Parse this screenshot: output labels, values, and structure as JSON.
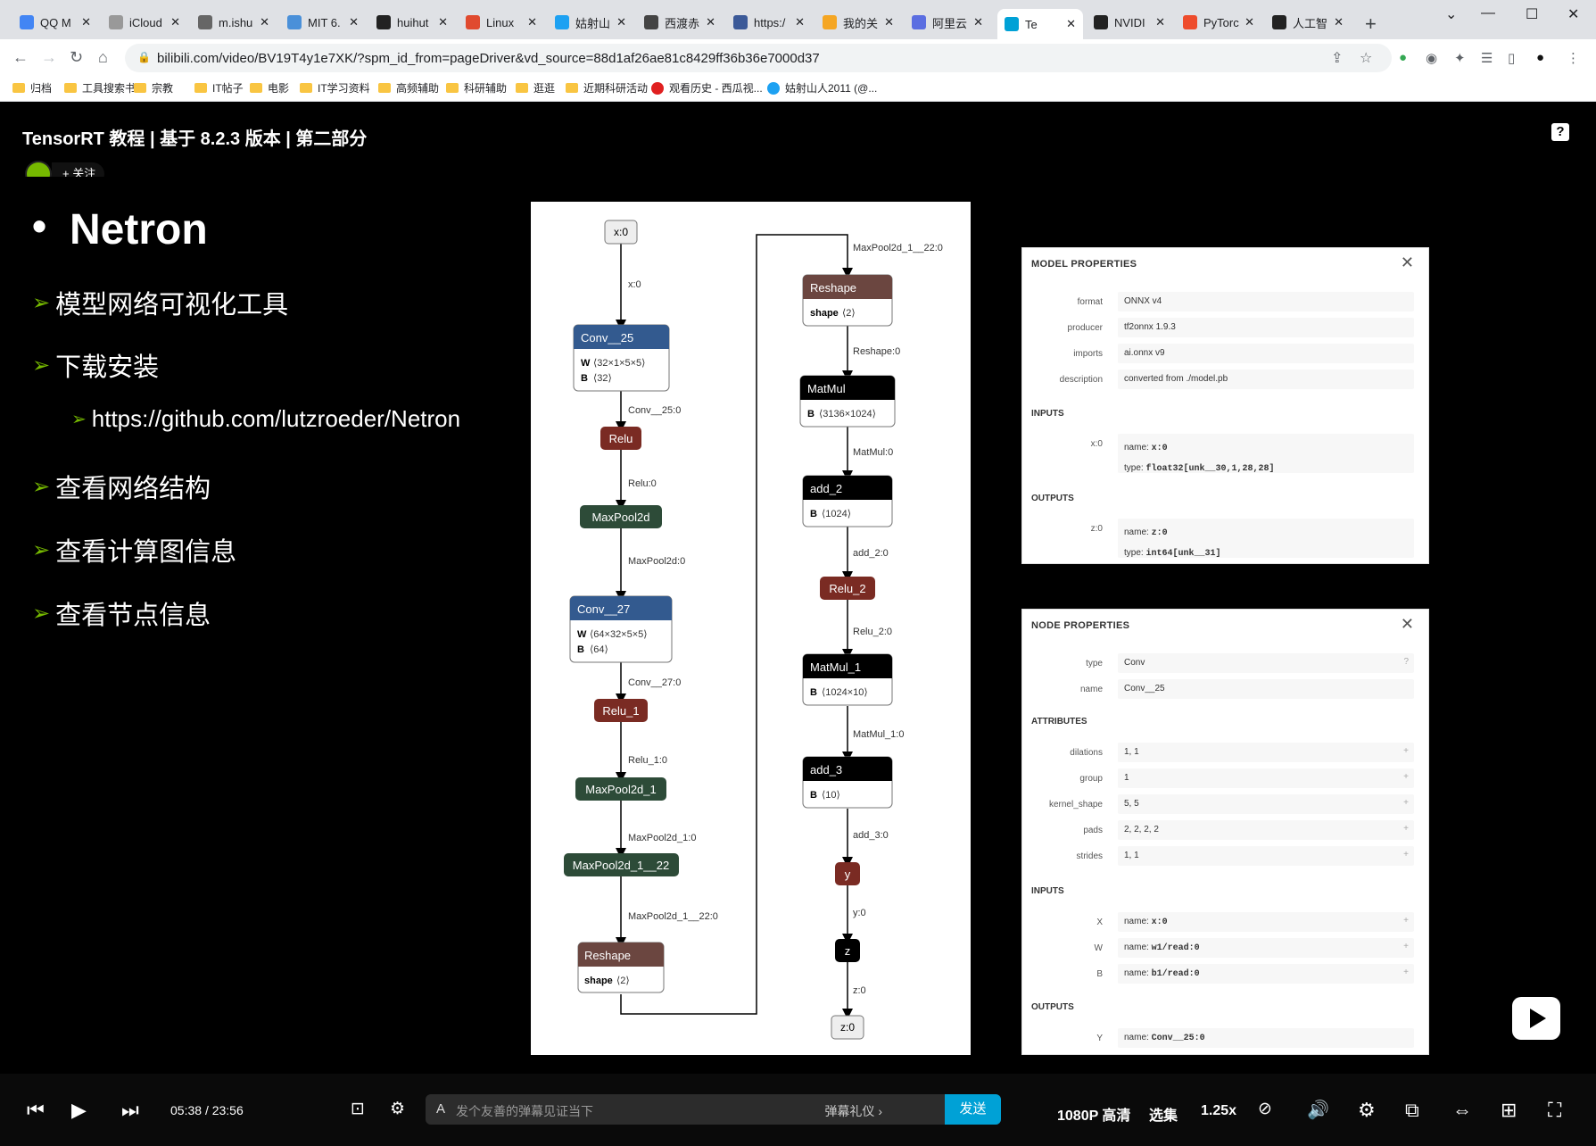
{
  "browser": {
    "tabs": [
      {
        "label": "QQ M",
        "color": "#4285f4"
      },
      {
        "label": "iCloud",
        "color": "#999999"
      },
      {
        "label": "m.ishu",
        "color": "#666666"
      },
      {
        "label": "MIT 6.",
        "color": "#4a90d9"
      },
      {
        "label": "huihut",
        "color": "#222222"
      },
      {
        "label": "Linux",
        "color": "#e04a2f"
      },
      {
        "label": "姑射山",
        "color": "#1da1f2"
      },
      {
        "label": "西渡赤",
        "color": "#444444"
      },
      {
        "label": "https:/",
        "color": "#3b5998"
      },
      {
        "label": "我的关",
        "color": "#f5a623"
      },
      {
        "label": "阿里云",
        "color": "#5b6ee1"
      },
      {
        "label": "Te",
        "color": "#00a1d6",
        "active": true
      },
      {
        "label": "NVIDI",
        "color": "#222222"
      },
      {
        "label": "PyTorc",
        "color": "#ee4c2c"
      },
      {
        "label": "人工智",
        "color": "#222222"
      }
    ],
    "url": "bilibili.com/video/BV19T4y1e7XK/?spm_id_from=pageDriver&vd_source=88d1af26ae81c8429ff36b36e7000d37",
    "bookmarks": [
      {
        "label": "归档",
        "type": "folder"
      },
      {
        "label": "工具搜索书",
        "type": "folder"
      },
      {
        "label": "宗教",
        "type": "folder"
      },
      {
        "label": "IT帖子",
        "type": "folder"
      },
      {
        "label": "电影",
        "type": "folder"
      },
      {
        "label": "IT学习资料",
        "type": "folder"
      },
      {
        "label": "高频辅助",
        "type": "folder"
      },
      {
        "label": "科研辅助",
        "type": "folder"
      },
      {
        "label": "逛逛",
        "type": "folder"
      },
      {
        "label": "近期科研活动",
        "type": "folder"
      },
      {
        "label": "观看历史 - 西瓜视...",
        "type": "site",
        "color": "#e02020"
      },
      {
        "label": "姑射山人2011 (@...",
        "type": "site",
        "color": "#1da1f2"
      }
    ]
  },
  "video": {
    "title": "TensorRT 教程 | 基于 8.2.3 版本 | 第二部分",
    "follow_label": "+ 关注",
    "current_time": "05:38",
    "separator": "/",
    "duration": "23:56",
    "danmaku_placeholder": "发个友善的弹幕见证当下",
    "danmaku_etiquette": "弹幕礼仪 ›",
    "send_label": "发送",
    "quality": "1080P 高清",
    "episodes": "选集",
    "speed": "1.25x"
  },
  "slide": {
    "title": "Netron",
    "items": [
      {
        "text": "模型网络可视化工具",
        "level": 1
      },
      {
        "text": "下载安装",
        "level": 1
      },
      {
        "text": "https://github.com/lutzroeder/Netron",
        "level": 2
      },
      {
        "text": "查看网络结构",
        "level": 1
      },
      {
        "text": "查看计算图信息",
        "level": 1
      },
      {
        "text": "查看节点信息",
        "level": 1
      }
    ]
  },
  "graph": {
    "input_node": "x:0",
    "output_node": "z:0",
    "edges_left": [
      "x:0",
      "Conv__25:0",
      "Relu:0",
      "MaxPool2d:0",
      "Conv__27:0",
      "Relu_1:0",
      "MaxPool2d_1:0",
      "MaxPool2d_1__22:0"
    ],
    "edges_right": [
      "MaxPool2d_1__22:0",
      "Reshape:0",
      "MatMul:0",
      "add_2:0",
      "Relu_2:0",
      "MatMul_1:0",
      "add_3:0",
      "y:0",
      "z:0"
    ],
    "nodes": {
      "conv25": {
        "name": "Conv__25",
        "attr1_key": "W",
        "attr1_val": "⟨32×1×5×5⟩",
        "attr2_key": "B",
        "attr2_val": "⟨32⟩"
      },
      "relu": {
        "name": "Relu"
      },
      "maxpool": {
        "name": "MaxPool2d"
      },
      "conv27": {
        "name": "Conv__27",
        "attr1_key": "W",
        "attr1_val": "⟨64×32×5×5⟩",
        "attr2_key": "B",
        "attr2_val": "⟨64⟩"
      },
      "relu1": {
        "name": "Relu_1"
      },
      "maxpool1": {
        "name": "MaxPool2d_1"
      },
      "maxpool1_22": {
        "name": "MaxPool2d_1__22"
      },
      "reshape_l": {
        "name": "Reshape",
        "attr_key": "shape",
        "attr_val": "⟨2⟩"
      },
      "reshape_r": {
        "name": "Reshape",
        "attr_key": "shape",
        "attr_val": "⟨2⟩"
      },
      "matmul": {
        "name": "MatMul",
        "attr_key": "B",
        "attr_val": "⟨3136×1024⟩"
      },
      "add2": {
        "name": "add_2",
        "attr_key": "B",
        "attr_val": "⟨1024⟩"
      },
      "relu2": {
        "name": "Relu_2"
      },
      "matmul1": {
        "name": "MatMul_1",
        "attr_key": "B",
        "attr_val": "⟨1024×10⟩"
      },
      "add3": {
        "name": "add_3",
        "attr_key": "B",
        "attr_val": "⟨10⟩"
      },
      "y": {
        "name": "y"
      },
      "z": {
        "name": "z"
      }
    },
    "colors": {
      "conv": "#335a8f",
      "relu": "#7a2b23",
      "pool": "#2d4b38",
      "reshape": "#6b4640",
      "black": "#000000"
    }
  },
  "model_props": {
    "title": "MODEL PROPERTIES",
    "rows": [
      {
        "label": "format",
        "value": "ONNX v4"
      },
      {
        "label": "producer",
        "value": "tf2onnx 1.9.3"
      },
      {
        "label": "imports",
        "value": "ai.onnx v9"
      },
      {
        "label": "description",
        "value": "converted from ./model.pb"
      }
    ],
    "inputs_label": "INPUTS",
    "input": {
      "label": "x:0",
      "name_key": "name:",
      "name": "x:0",
      "type_key": "type:",
      "type": "float32[unk__30,1,28,28]"
    },
    "outputs_label": "OUTPUTS",
    "output": {
      "label": "z:0",
      "name_key": "name:",
      "name": "z:0",
      "type_key": "type:",
      "type": "int64[unk__31]"
    }
  },
  "node_props": {
    "title": "NODE PROPERTIES",
    "rows": [
      {
        "label": "type",
        "value": "Conv"
      },
      {
        "label": "name",
        "value": "Conv__25"
      }
    ],
    "attributes_label": "ATTRIBUTES",
    "attributes": [
      {
        "label": "dilations",
        "value": "1, 1"
      },
      {
        "label": "group",
        "value": "1"
      },
      {
        "label": "kernel_shape",
        "value": "5, 5"
      },
      {
        "label": "pads",
        "value": "2, 2, 2, 2"
      },
      {
        "label": "strides",
        "value": "1, 1"
      }
    ],
    "inputs_label": "INPUTS",
    "inputs": [
      {
        "label": "X",
        "name_key": "name:",
        "value": "x:0"
      },
      {
        "label": "W",
        "name_key": "name:",
        "value": "w1/read:0"
      },
      {
        "label": "B",
        "name_key": "name:",
        "value": "b1/read:0"
      }
    ],
    "outputs_label": "OUTPUTS",
    "outputs": [
      {
        "label": "Y",
        "name_key": "name:",
        "value": "Conv__25:0"
      }
    ]
  }
}
